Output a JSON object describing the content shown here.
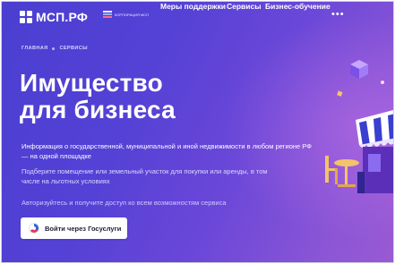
{
  "header": {
    "logo_text": "МСП.РФ",
    "partner_text": "Корпорация МСП",
    "nav": [
      "Меры поддержки",
      "Сервисы",
      "Бизнес-обучение"
    ],
    "more": "•••"
  },
  "breadcrumb": [
    "ГЛАВНАЯ",
    "СЕРВИСЫ"
  ],
  "hero": {
    "title_line1": "Имущество",
    "title_line2": "для бизнеса",
    "paragraph1": "Информация о государственной, муниципальной и иной недвижимости в любом регионе РФ — на одной площадке",
    "paragraph2": "Подберите помещение или земельный участок для покупки или аренды, в том числе на льготных условиях",
    "paragraph3": "Авторизуйтесь и получите доступ ко всем возможностям сервиса",
    "button_label": "Войти через Госуслуги"
  },
  "icons": {
    "gosuslugi": "gosuslugi-logo-icon",
    "logo": "msp-logo-icon"
  },
  "colors": {
    "background_start": "#4a3fd0",
    "background_end": "#9a5ad2",
    "button_bg": "#ffffff",
    "text": "#ffffff"
  }
}
